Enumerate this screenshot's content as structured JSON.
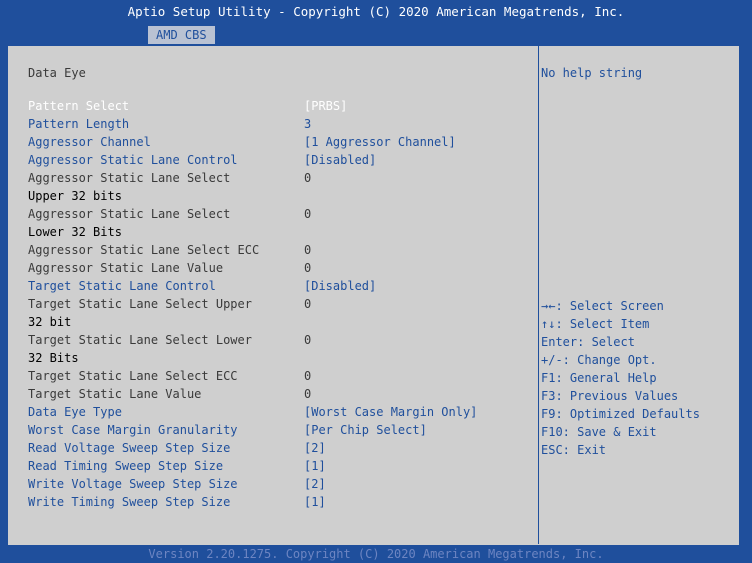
{
  "header": {
    "title": "Aptio Setup Utility - Copyright (C) 2020 American Megatrends, Inc.",
    "tab": "AMD CBS"
  },
  "page_title": "Data Eye",
  "settings": [
    {
      "label": "Pattern Select",
      "value": "[PRBS]",
      "style": "selected"
    },
    {
      "label": "Pattern Length",
      "value": "3",
      "style": "editable"
    },
    {
      "label": "Aggressor Channel",
      "value": "[1 Aggressor Channel]",
      "style": "editable"
    },
    {
      "label": "Aggressor Static Lane Control",
      "value": "[Disabled]",
      "style": "editable"
    },
    {
      "label": "Aggressor Static Lane Select",
      "label2": "Upper 32 bits",
      "value": "0",
      "style": "readonly"
    },
    {
      "label": "Aggressor Static Lane Select",
      "label2": "Lower 32 Bits",
      "value": "0",
      "style": "readonly"
    },
    {
      "label": "Aggressor Static Lane Select ECC",
      "value": "0",
      "style": "readonly"
    },
    {
      "label": "Aggressor Static Lane Value",
      "value": "0",
      "style": "readonly"
    },
    {
      "label": "Target Static Lane Control",
      "value": "[Disabled]",
      "style": "editable"
    },
    {
      "label": "Target Static Lane Select Upper",
      "label2": "32 bit",
      "value": "0",
      "style": "readonly"
    },
    {
      "label": "Target Static Lane Select Lower",
      "label2": "32 Bits",
      "value": "0",
      "style": "readonly"
    },
    {
      "label": "Target Static Lane Select ECC",
      "value": "0",
      "style": "readonly"
    },
    {
      "label": "Target Static Lane Value",
      "value": "0",
      "style": "readonly"
    },
    {
      "label": "Data Eye Type",
      "value": "[Worst Case Margin Only]",
      "style": "editable"
    },
    {
      "label": "Worst Case Margin Granularity",
      "value": "[Per Chip Select]",
      "style": "editable"
    },
    {
      "label": "Read Voltage Sweep Step Size",
      "value": "[2]",
      "style": "editable"
    },
    {
      "label": "Read Timing Sweep Step Size",
      "value": "[1]",
      "style": "editable"
    },
    {
      "label": "Write Voltage Sweep Step Size",
      "value": "[2]",
      "style": "editable"
    },
    {
      "label": "Write Timing Sweep Step Size",
      "value": "[1]",
      "style": "editable"
    }
  ],
  "help": "No help string",
  "keys": [
    "→←: Select Screen",
    "↑↓: Select Item",
    "Enter: Select",
    "+/-: Change Opt.",
    "F1: General Help",
    "F3: Previous Values",
    "F9: Optimized Defaults",
    "F10: Save & Exit",
    "ESC: Exit"
  ],
  "footer": "Version 2.20.1275. Copyright (C) 2020 American Megatrends, Inc."
}
